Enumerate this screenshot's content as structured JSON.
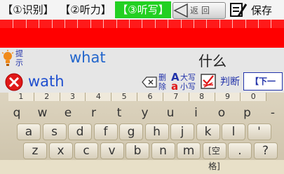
{
  "tabs": [
    {
      "label": "【①识别】"
    },
    {
      "label": "【②听力】"
    },
    {
      "label": "【③听写】"
    }
  ],
  "back_label": "返回",
  "save_label": "保存",
  "hint_label": "提示",
  "word": "what",
  "meaning": "什么",
  "answer": "wath",
  "controls": {
    "delete_label": "删除",
    "case_upper": "大写",
    "case_lower": "小写",
    "case_letters": {
      "upper": "A",
      "lower": "a"
    },
    "judge_label": "判断",
    "next_label": "【下一个】"
  },
  "keyboard": {
    "numbers": [
      "1",
      "2",
      "3",
      "4",
      "5",
      "6",
      "7",
      "8",
      "9",
      "0"
    ],
    "row1": [
      "q",
      "w",
      "e",
      "r",
      "t",
      "y",
      "u",
      "i",
      "o",
      "p",
      "-"
    ],
    "row2": [
      "a",
      "s",
      "d",
      "f",
      "g",
      "h",
      "j",
      "k",
      "l",
      "'"
    ],
    "row3": [
      "z",
      "x",
      "c",
      "v",
      "b",
      "n",
      "m",
      "[空格]",
      ".",
      "?"
    ]
  },
  "colors": {
    "active_tab": "#22d022",
    "progress_red": "#ff0000",
    "word_blue": "#2266cc"
  }
}
